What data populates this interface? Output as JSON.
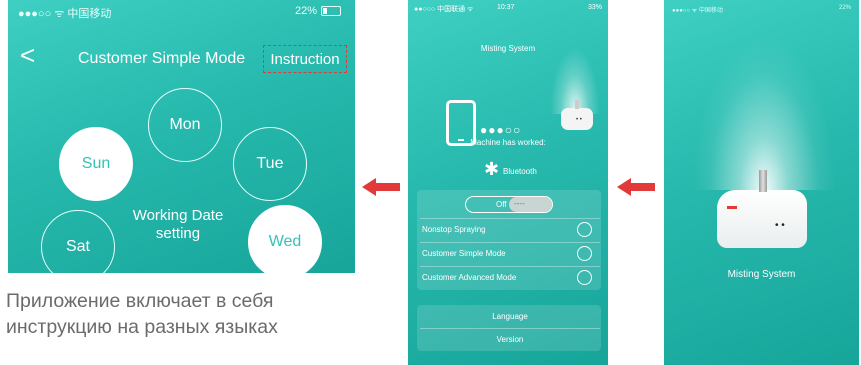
{
  "left_screen": {
    "status": {
      "carrier": "●●●○○ ᯤ 中国移动",
      "battery": "22%"
    },
    "back_glyph": "<",
    "title": "Customer Simple Mode",
    "instruction_button": "Instruction",
    "days": [
      {
        "label": "Mon",
        "selected": false
      },
      {
        "label": "Sun",
        "selected": true
      },
      {
        "label": "Tue",
        "selected": false
      },
      {
        "label": "Sat",
        "selected": false
      },
      {
        "label": "Wed",
        "selected": true
      }
    ],
    "center_label_line1": "Working Date",
    "center_label_line2": "setting"
  },
  "caption": {
    "line1": "Приложение включает в себя",
    "line2": "инструкцию на разных языках"
  },
  "middle_screen": {
    "status": {
      "carrier": "●●○○○ 中国联通 ᯤ",
      "time": "10:37",
      "battery": "33%"
    },
    "title": "Misting System",
    "connection_dots": "●●●○○",
    "machine_face": "• •",
    "worked_text": "Machine has worked:",
    "bluetooth_label": "Bluetooth",
    "toggle": {
      "label": "Off",
      "knob_text": "----"
    },
    "modes": [
      "Nonstop Spraying",
      "Customer Simple Mode",
      "Customer Advanced Mode"
    ],
    "bottom_buttons": [
      "Language",
      "Version"
    ]
  },
  "right_screen": {
    "status": {
      "carrier": "●●●○○ ᯤ 中国移动",
      "battery": "22%"
    },
    "machine_face": "• •",
    "title": "Misting System"
  },
  "colors": {
    "teal": "#2bbdb1",
    "arrow_red": "#e23a3a"
  },
  "icons": [
    "back-chevron-icon",
    "battery-icon",
    "phone-icon",
    "bluetooth-icon",
    "arrow-left-icon",
    "radio-icon"
  ]
}
